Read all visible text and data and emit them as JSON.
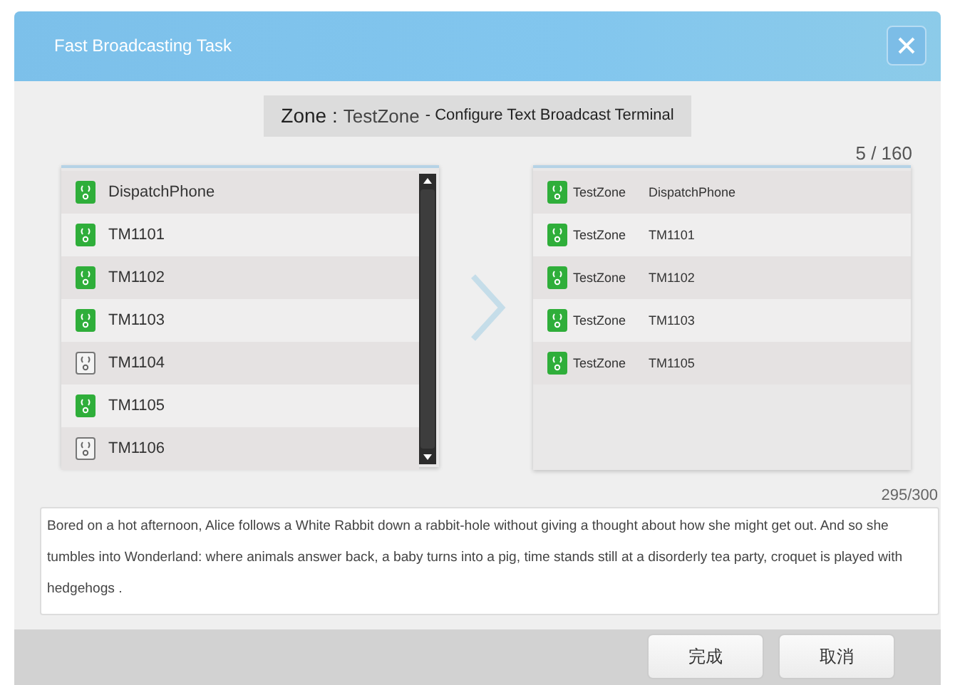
{
  "window": {
    "title": "Fast Broadcasting Task"
  },
  "zone": {
    "label": "Zone :",
    "name": "TestZone",
    "description": "- Configure Text Broadcast Terminal"
  },
  "counter": "5 / 160",
  "available_terminals": [
    {
      "name": "DispatchPhone",
      "online": true
    },
    {
      "name": "TM1101",
      "online": true
    },
    {
      "name": "TM1102",
      "online": true
    },
    {
      "name": "TM1103",
      "online": true
    },
    {
      "name": "TM1104",
      "online": false
    },
    {
      "name": "TM1105",
      "online": true
    },
    {
      "name": "TM1106",
      "online": false
    }
  ],
  "selected_terminals": [
    {
      "zone": "TestZone",
      "name": "DispatchPhone",
      "online": true
    },
    {
      "zone": "TestZone",
      "name": "TM1101",
      "online": true
    },
    {
      "zone": "TestZone",
      "name": "TM1102",
      "online": true
    },
    {
      "zone": "TestZone",
      "name": "TM1103",
      "online": true
    },
    {
      "zone": "TestZone",
      "name": "TM1105",
      "online": true
    }
  ],
  "message": {
    "char_count": "295/300",
    "value": "Bored on a hot afternoon, Alice follows a White Rabbit down a rabbit-hole without giving a thought about how she might get out. And so she tumbles into Wonderland: where animals answer back, a baby turns into a pig, time stands still at a disorderly tea party, croquet is played with hedgehogs ."
  },
  "buttons": [
    "完成",
    "取消"
  ]
}
